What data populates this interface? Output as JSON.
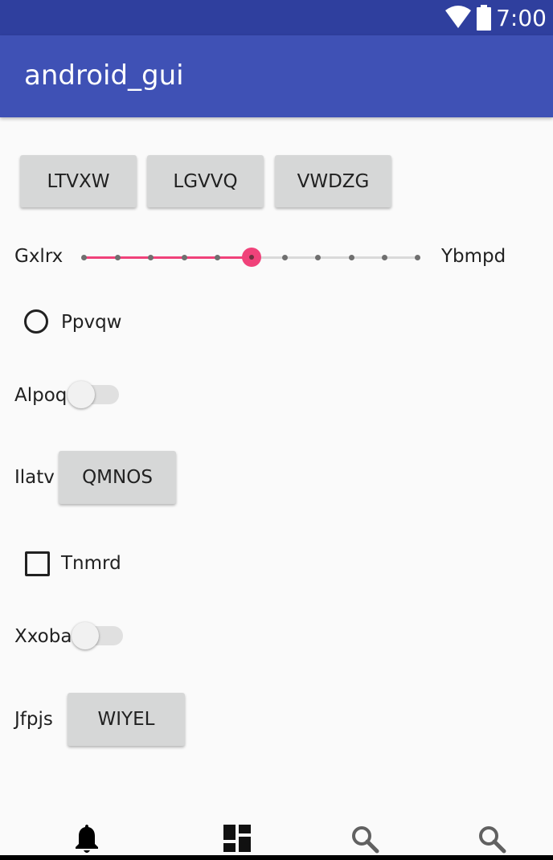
{
  "status_bar": {
    "time": "7:00",
    "icons": [
      "wifi-icon",
      "battery-icon"
    ]
  },
  "app_bar": {
    "title": "android_gui"
  },
  "buttons_row": [
    "LTVXW",
    "LGVVQ",
    "VWDZG"
  ],
  "seekbar": {
    "left_label": "Gxlrx",
    "right_label": "Ybmpd",
    "value": 5,
    "max": 10
  },
  "radio": {
    "label": "Ppvqw",
    "checked": false
  },
  "switch1": {
    "label": "Alpoq",
    "on": false
  },
  "button_row2": {
    "label": "Ilatv",
    "button": "QMNOS"
  },
  "checkbox": {
    "label": "Tnmrd",
    "checked": false
  },
  "switch2": {
    "label": "Xxoba",
    "on": false
  },
  "button_row3": {
    "label": "Jfpjs",
    "button": "WIYEL"
  },
  "bottom_nav": {
    "items": [
      "bell-icon",
      "dashboard-icon",
      "search-icon",
      "search-icon"
    ]
  },
  "colors": {
    "status_bar": "#2f3f9e",
    "app_bar": "#3f51b5",
    "accent": "#f0427a"
  }
}
